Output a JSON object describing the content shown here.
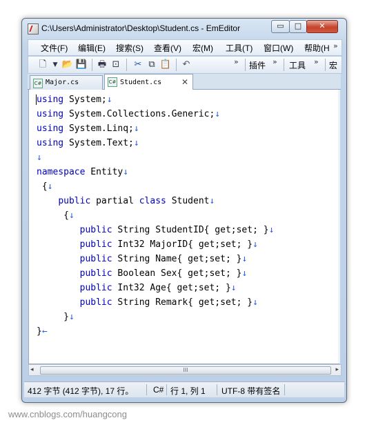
{
  "window": {
    "title": "C:\\Users\\Administrator\\Desktop\\Student.cs - EmEditor",
    "min_label": "▭",
    "max_label": "□",
    "close_label": "✕"
  },
  "menu": {
    "items": [
      "文件(F)",
      "编辑(E)",
      "搜索(S)",
      "查看(V)",
      "宏(M)",
      "工具(T)",
      "窗口(W)",
      "帮助(H"
    ],
    "overflow": "»"
  },
  "toolbar": {
    "plugins_label": "插件",
    "tools_label": "工具",
    "macro_label": "宏",
    "overflow": "»"
  },
  "tabs": [
    {
      "label": "Major.cs",
      "icon_text": "C#"
    },
    {
      "label": "Student.cs",
      "icon_text": "C#",
      "close": "✕"
    }
  ],
  "code": {
    "newline_mark": "↓",
    "eof_mark": "←",
    "lines": [
      [
        {
          "t": "using",
          "k": 1
        },
        {
          "t": " System;"
        }
      ],
      [
        {
          "t": "using",
          "k": 1
        },
        {
          "t": " System.Collections.Generic;"
        }
      ],
      [
        {
          "t": "using",
          "k": 1
        },
        {
          "t": " System.Linq;"
        }
      ],
      [
        {
          "t": "using",
          "k": 1
        },
        {
          "t": " System.Text;"
        }
      ],
      [],
      [
        {
          "t": "namespace",
          "k": 1
        },
        {
          "t": " Entity"
        }
      ],
      [
        {
          "t": " {"
        }
      ],
      [
        {
          "t": "    "
        },
        {
          "t": "public",
          "k": 1
        },
        {
          "t": " partial "
        },
        {
          "t": "class",
          "k": 1
        },
        {
          "t": " Student"
        }
      ],
      [
        {
          "t": "     {"
        }
      ],
      [
        {
          "t": "        "
        },
        {
          "t": "public",
          "k": 1
        },
        {
          "t": " String StudentID{ get;set; }"
        }
      ],
      [
        {
          "t": "        "
        },
        {
          "t": "public",
          "k": 1
        },
        {
          "t": " Int32 MajorID{ get;set; }"
        }
      ],
      [
        {
          "t": "        "
        },
        {
          "t": "public",
          "k": 1
        },
        {
          "t": " String Name{ get;set; }"
        }
      ],
      [
        {
          "t": "        "
        },
        {
          "t": "public",
          "k": 1
        },
        {
          "t": " Boolean Sex{ get;set; }"
        }
      ],
      [
        {
          "t": "        "
        },
        {
          "t": "public",
          "k": 1
        },
        {
          "t": " Int32 Age{ get;set; }"
        }
      ],
      [
        {
          "t": "        "
        },
        {
          "t": "public",
          "k": 1
        },
        {
          "t": " String Remark{ get;set; }"
        }
      ],
      [
        {
          "t": "     }"
        }
      ],
      [
        {
          "t": "}"
        }
      ]
    ]
  },
  "scrollbar": {
    "left_arrow": "◂",
    "right_arrow": "▸",
    "grip": "III"
  },
  "status": {
    "size": "412 字节 (412 字节), 17 行。",
    "language": "C#",
    "position": "行 1, 列 1",
    "encoding": "UTF-8 带有签名"
  },
  "watermark": "www.cnblogs.com/huangcong"
}
